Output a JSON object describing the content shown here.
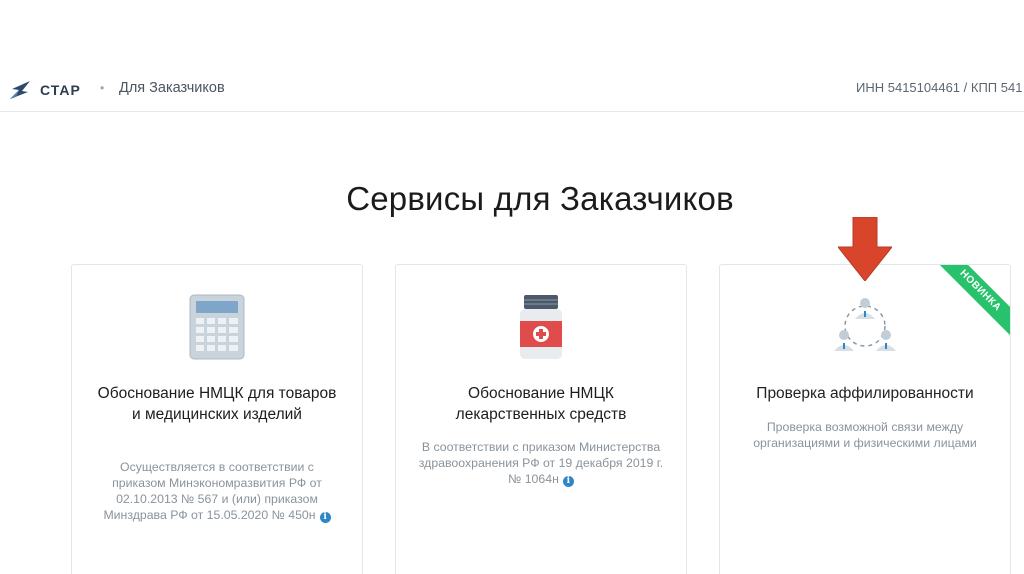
{
  "header": {
    "brand": "СТАР",
    "separator": "•",
    "section": "Для Заказчиков",
    "org_info": "ИНН 5415104461 / КПП 541"
  },
  "page": {
    "title": "Сервисы для Заказчиков"
  },
  "cards": [
    {
      "title": "Обоснование НМЦК для товаров и медицинских изделий",
      "description": "Осуществляется в соответствии с приказом Минэкономразвития РФ от 02.10.2013 № 567 и (или) приказом Минздрава РФ от 15.05.2020 № 450н",
      "icon": "calculator-icon",
      "info_icon": "i"
    },
    {
      "title": "Обоснование НМЦК лекарственных средств",
      "description": "В соответствии с приказом Министерства здравоохранения РФ от 19 декабря 2019 г. № 1064н",
      "icon": "medicine-bottle-icon",
      "info_icon": "i"
    },
    {
      "title": "Проверка аффилированности",
      "description": "Проверка возможной связи между организациями и физическими лицами",
      "icon": "people-network-icon",
      "badge": "НОВИНКА"
    }
  ],
  "colors": {
    "accent": "#2f86c7",
    "badge": "#27c26b",
    "arrow": "#d9452b"
  }
}
